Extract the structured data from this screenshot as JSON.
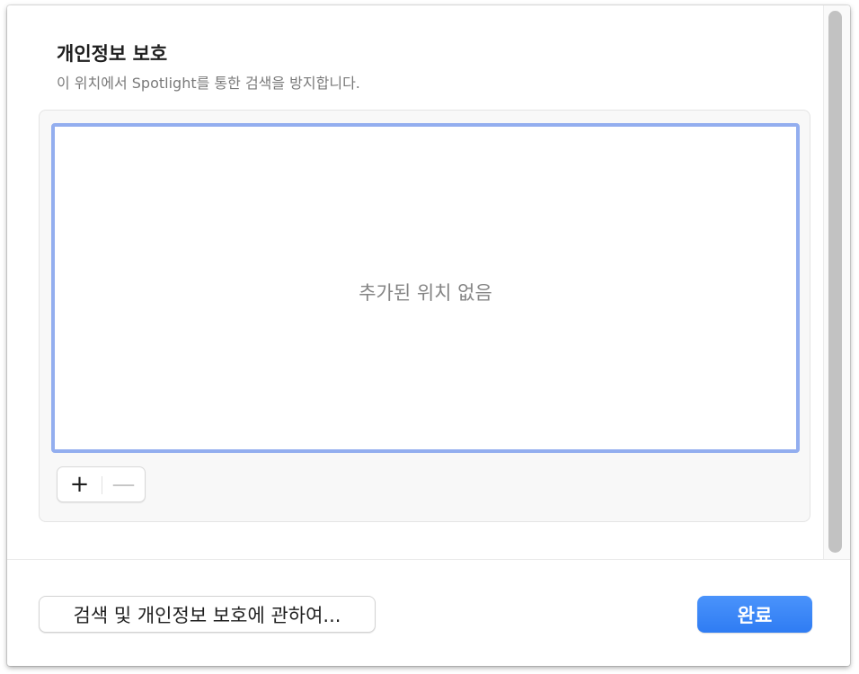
{
  "privacy": {
    "title": "개인정보 보호",
    "subtitle": "이 위치에서 Spotlight를 통한 검색을 방지합니다."
  },
  "locations_list": {
    "empty_message": "추가된 위치 없음",
    "items": []
  },
  "list_controls": {
    "add_symbol": "+",
    "remove_symbol": "—"
  },
  "footer": {
    "about_button_label": "검색 및 개인정보 보호에 관하여...",
    "done_button_label": "완료"
  },
  "colors": {
    "accent": "#2f7cf3",
    "focus_ring": "#93aeef",
    "secondary_text": "#7a7a7a"
  },
  "icons": {
    "add": "plus-icon",
    "remove": "minus-icon"
  }
}
